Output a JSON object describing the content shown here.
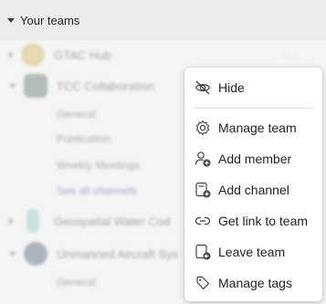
{
  "section": {
    "title": "Your teams"
  },
  "teams": [
    {
      "name": "GTAC Hub",
      "channels": []
    },
    {
      "name": "TCC Collaboration",
      "channels": [
        "General",
        "Publication",
        "Weekly Meetings",
        "See all channels"
      ]
    },
    {
      "name": "Geospatial Water Cod",
      "channels": []
    },
    {
      "name": "Unmanned Aircraft Sys",
      "channels": [
        "General",
        ""
      ]
    }
  ],
  "context_menu": {
    "items": [
      {
        "label": "Hide",
        "icon": "hide-icon"
      },
      {
        "label": "Manage team",
        "icon": "gear-icon"
      },
      {
        "label": "Add member",
        "icon": "add-member-icon"
      },
      {
        "label": "Add channel",
        "icon": "add-channel-icon"
      },
      {
        "label": "Get link to team",
        "icon": "link-icon"
      },
      {
        "label": "Leave team",
        "icon": "leave-icon"
      },
      {
        "label": "Manage tags",
        "icon": "tag-icon"
      }
    ]
  },
  "colors": {
    "accent": "#6264a7",
    "header_bg": "#ebebeb",
    "menu_bg": "#ffffff"
  }
}
